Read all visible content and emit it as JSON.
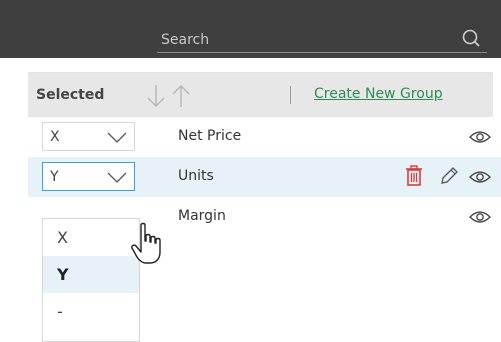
{
  "search": {
    "placeholder": "Search"
  },
  "header": {
    "selected_label": "Selected",
    "create_group_link": "Create New Group"
  },
  "rows": [
    {
      "axis": "X",
      "label": "Net Price",
      "highlighted": false
    },
    {
      "axis": "Y",
      "label": "Units",
      "highlighted": true
    },
    {
      "axis": "",
      "label": "Margin",
      "highlighted": false
    }
  ],
  "dropdown": {
    "options": [
      "X",
      "Y",
      "-"
    ],
    "selected": "Y"
  },
  "colors": {
    "topbar": "#3f3f3f",
    "header_bg": "#e7e7e7",
    "highlight_row": "#e6f1f8",
    "link": "#2e8b57",
    "trash": "#e03c3c",
    "active_border": "#3fa0d6"
  },
  "icons": [
    "search-icon",
    "sort-descending-icon",
    "sort-ascending-icon",
    "chevron-down-icon",
    "eye-icon",
    "trash-icon",
    "pencil-icon",
    "hand-pointer-cursor-icon"
  ]
}
